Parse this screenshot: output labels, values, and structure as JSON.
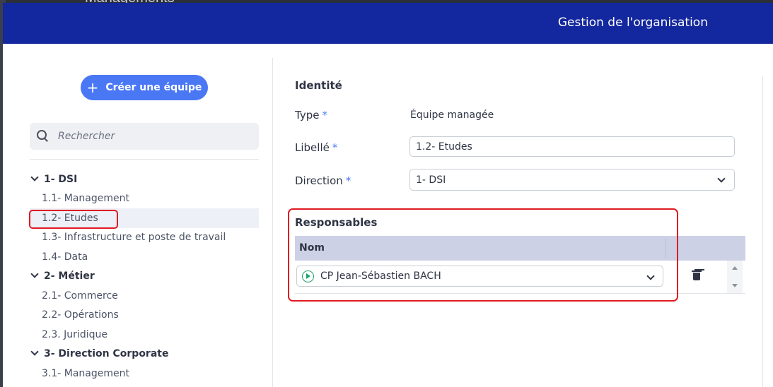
{
  "backdrop": {
    "title": "Managements"
  },
  "header": {
    "title": "Gestion de l'organisation"
  },
  "left": {
    "create_label": "Créer une équipe",
    "search_placeholder": "Rechercher",
    "tree": [
      {
        "label": "1- DSI",
        "children": [
          "1.1- Management",
          "1.2- Etudes",
          "1.3- Infrastructure et poste de travail",
          "1.4- Data"
        ]
      },
      {
        "label": "2- Métier",
        "children": [
          "2.1- Commerce",
          "2.2- Opérations",
          "2.3. Juridique"
        ]
      },
      {
        "label": "3- Direction Corporate",
        "children": [
          "3.1- Management"
        ]
      }
    ],
    "selected": "1.2- Etudes"
  },
  "form": {
    "identity_title": "Identité",
    "type_label": "Type",
    "type_value": "Équipe managée",
    "libelle_label": "Libellé",
    "libelle_value": "1.2- Etudes",
    "direction_label": "Direction",
    "direction_value": "1- DSI",
    "required_mark": "*"
  },
  "responsables": {
    "title": "Responsables",
    "column_nom": "Nom",
    "rows": [
      {
        "name": "CP Jean-Sébastien BACH"
      }
    ]
  },
  "colors": {
    "header": "#13279e",
    "accent": "#4a78f5",
    "highlight": "#e11b22",
    "status_green": "#1aa36b"
  }
}
